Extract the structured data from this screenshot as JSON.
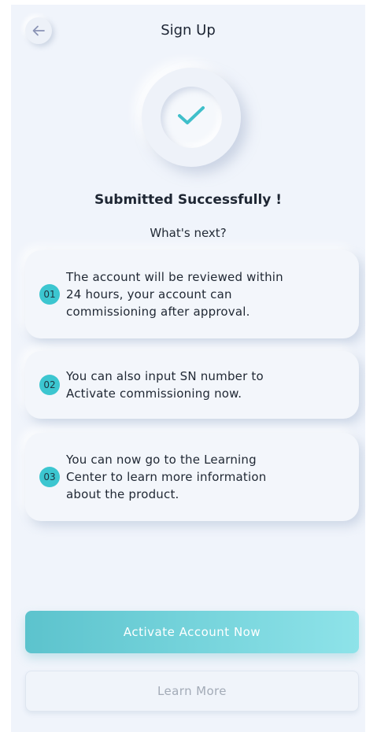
{
  "header": {
    "title": "Sign Up",
    "back_icon": "arrow-left-icon"
  },
  "status": {
    "icon": "checkmark-icon",
    "title": "Submitted Successfully !",
    "subtitle": "What's next?"
  },
  "steps": [
    {
      "number": "01",
      "lines": [
        "The account will be reviewed within",
        "24 hours, your account can",
        "commissioning after approval."
      ]
    },
    {
      "number": "02",
      "lines": [
        "You can also input SN number to",
        "Activate commissioning now."
      ]
    },
    {
      "number": "03",
      "lines": [
        "You can now go to the Learning",
        "Center to learn more information",
        "about the product."
      ]
    }
  ],
  "actions": {
    "primary_label": "Activate Account Now",
    "secondary_label": "Learn More"
  },
  "colors": {
    "accent": "#3cc6d0",
    "background": "#f0f4fb",
    "checkmark": "#3fbfca",
    "back_arrow": "#8a93b5"
  }
}
